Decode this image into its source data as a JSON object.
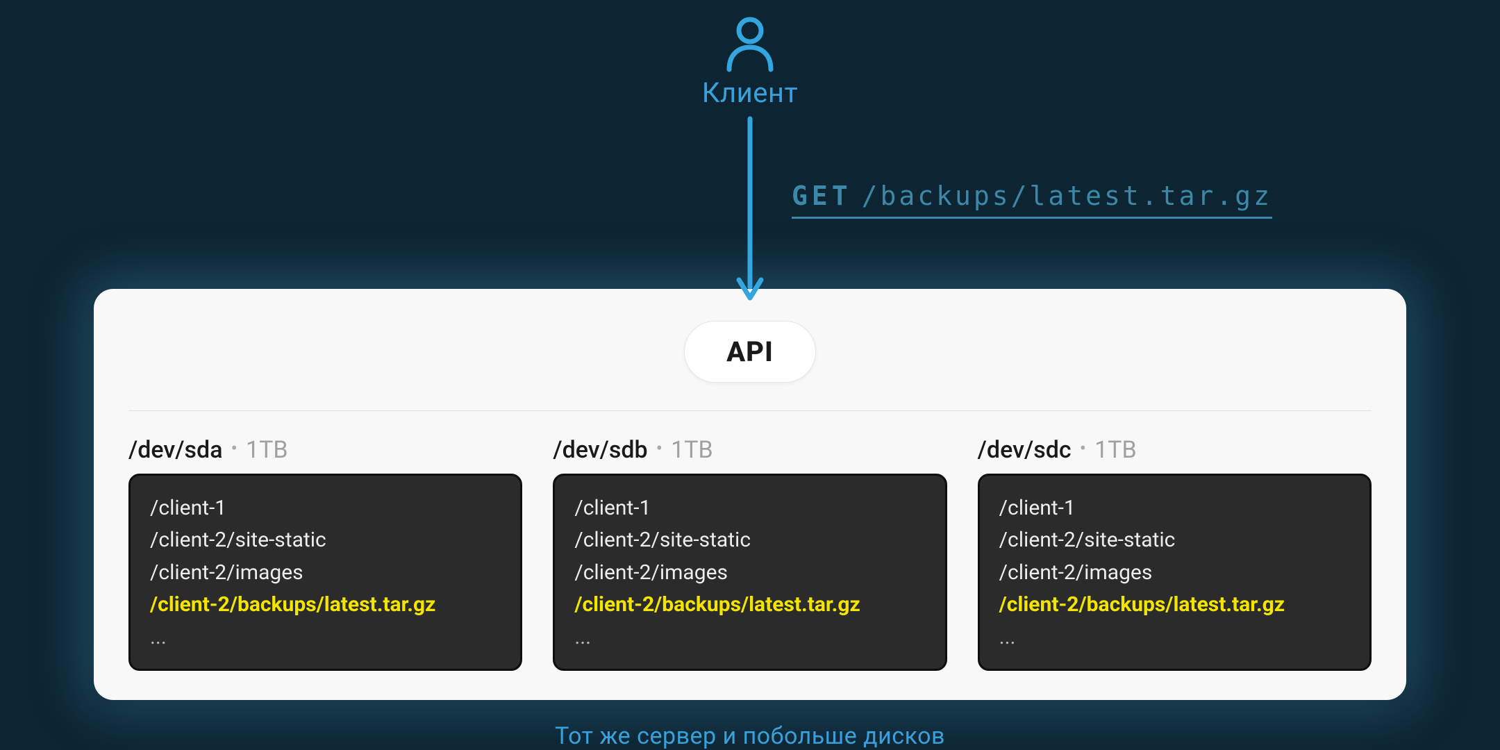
{
  "client": {
    "label": "Клиент"
  },
  "request": {
    "method": "GET",
    "path": "/backups/latest.tar.gz"
  },
  "server": {
    "api_label": "API",
    "disks": [
      {
        "name": "/dev/sda",
        "size": "1TB",
        "entries": [
          "/client-1",
          "/client-2/site-static",
          "/client-2/images"
        ],
        "highlighted": "/client-2/backups/latest.tar.gz",
        "more": "..."
      },
      {
        "name": "/dev/sdb",
        "size": "1TB",
        "entries": [
          "/client-1",
          "/client-2/site-static",
          "/client-2/images"
        ],
        "highlighted": "/client-2/backups/latest.tar.gz",
        "more": "..."
      },
      {
        "name": "/dev/sdc",
        "size": "1TB",
        "entries": [
          "/client-1",
          "/client-2/site-static",
          "/client-2/images"
        ],
        "highlighted": "/client-2/backups/latest.tar.gz",
        "more": "..."
      }
    ]
  },
  "caption": "Тот же сервер и побольше дисков",
  "colors": {
    "bg": "#0d2432",
    "accent": "#3aa0db",
    "panel": "#f8f8f8",
    "disk_bg": "#2b2b2b",
    "highlight": "#f4e500"
  }
}
